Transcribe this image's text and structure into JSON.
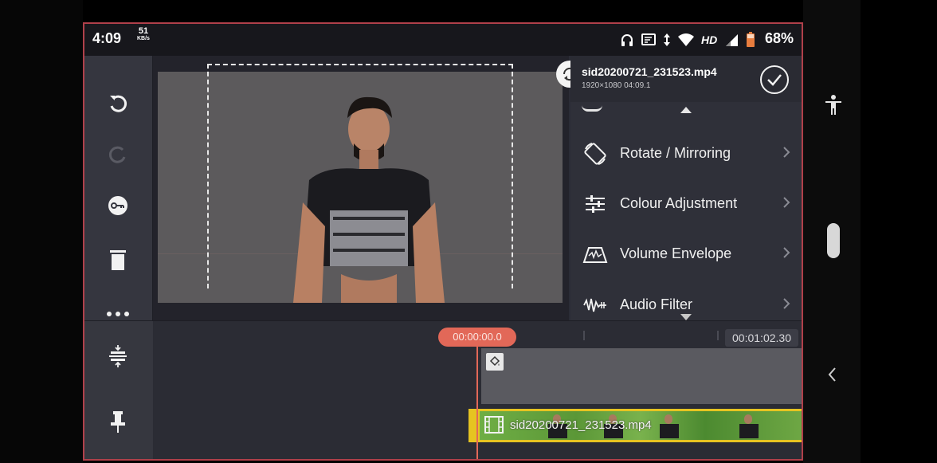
{
  "statusbar": {
    "time": "4:09",
    "net_speed_value": "51",
    "net_speed_unit": "KB/s",
    "network_type": "HD",
    "battery_percent": "68%",
    "icons": [
      "headphones-icon",
      "cast-icon",
      "data-arrows-icon",
      "wifi-icon",
      "signal-icon",
      "battery-icon"
    ]
  },
  "toolbar": {
    "items": [
      "undo-icon",
      "redo-icon",
      "keyframe-icon",
      "delete-icon",
      "more-icon"
    ]
  },
  "panel": {
    "file_name": "sid20200721_231523.mp4",
    "file_meta": "1920×1080  04:09.1",
    "items": [
      {
        "label": "Rotate / Mirroring",
        "icon": "rotate-icon"
      },
      {
        "label": "Colour Adjustment",
        "icon": "sliders-icon"
      },
      {
        "label": "Volume Envelope",
        "icon": "volume-envelope-icon"
      },
      {
        "label": "Audio Filter",
        "icon": "audio-filter-icon"
      }
    ]
  },
  "timeline": {
    "playhead_time": "00:00:00.0",
    "end_time": "00:01:02.30",
    "clip_label": "sid20200721_231523.mp4",
    "tools": [
      "split-icon",
      "pin-icon"
    ]
  },
  "colors": {
    "accent": "#e26858",
    "clip_border": "#e6c421",
    "frame_border": "#b0404a"
  }
}
